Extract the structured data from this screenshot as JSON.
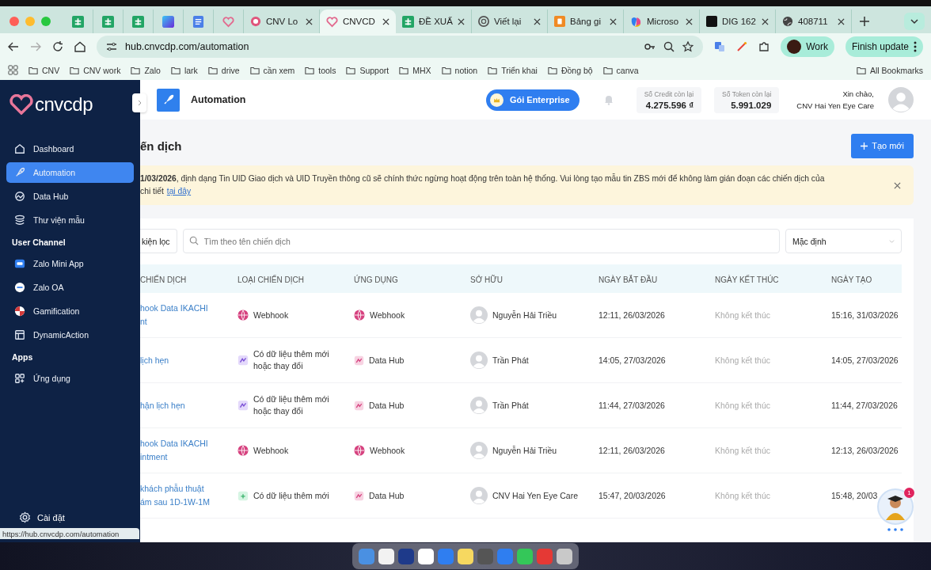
{
  "browser": {
    "tabs": [
      {
        "kind": "sheet",
        "selected": false
      },
      {
        "kind": "sheet",
        "selected": false
      },
      {
        "kind": "sheet",
        "selected": false
      },
      {
        "kind": "gradient",
        "selected": false
      },
      {
        "kind": "doc",
        "selected": false
      },
      {
        "kind": "heart",
        "selected": false
      },
      {
        "kind": "shield",
        "title": "CNV Lo",
        "selected": false
      },
      {
        "kind": "heart",
        "title": "CNVCD",
        "selected": true
      },
      {
        "kind": "sheet",
        "title": "ĐỀ XUẤ",
        "selected": false
      },
      {
        "kind": "knot",
        "title": "Viết lại",
        "selected": false
      },
      {
        "kind": "orange",
        "title": "Bảng gi",
        "selected": false
      },
      {
        "kind": "copilot",
        "title": "Microso",
        "selected": false
      },
      {
        "kind": "ty",
        "title": "DIG 162",
        "selected": false
      },
      {
        "kind": "globe",
        "title": "408711",
        "selected": false
      }
    ],
    "address": "hub.cnvcdp.com/automation",
    "profile": "Work",
    "update": "Finish update",
    "bookmarks": [
      "CNV",
      "CNV work",
      "Zalo",
      "lark",
      "drive",
      "cần xem",
      "tools",
      "Support",
      "MHX",
      "notion",
      "Triển khai",
      "Đồng bộ",
      "canva"
    ],
    "all_bookmarks": "All Bookmarks",
    "status_url": "https://hub.cnvcdp.com/automation"
  },
  "sidebar": {
    "logo": "cnvcdp",
    "nav": [
      {
        "kind": "item",
        "label": "Dashboard",
        "selected": false
      },
      {
        "kind": "item",
        "label": "Automation",
        "selected": true
      },
      {
        "kind": "item",
        "label": "Data Hub",
        "selected": false
      },
      {
        "kind": "item",
        "label": "Thư viện mẫu",
        "selected": false
      },
      {
        "kind": "heading",
        "label": "User Channel"
      },
      {
        "kind": "item",
        "label": "Zalo Mini App",
        "selected": false
      },
      {
        "kind": "item",
        "label": "Zalo OA",
        "selected": false
      },
      {
        "kind": "item",
        "label": "Gamification",
        "selected": false
      },
      {
        "kind": "item",
        "label": "DynamicAction",
        "selected": false
      },
      {
        "kind": "heading",
        "label": "Apps"
      },
      {
        "kind": "item",
        "label": "Ứng dụng",
        "selected": false
      }
    ],
    "settings": "Cài đặt"
  },
  "header": {
    "title": "Automation",
    "plan": "Gói Enterprise",
    "credit": {
      "label": "Số Credit còn lại",
      "value": "4.275.596 ₫"
    },
    "token": {
      "label": "Số Token còn lại",
      "value": "5.991.029"
    },
    "greeting": "Xin chào,",
    "user": "CNV Hai Yen Eye Care"
  },
  "page": {
    "title": "ến dịch",
    "create_button": "Tạo mới",
    "banner": {
      "line1": "**1/03/2026**, định dạng Tin UID Giao dịch và UID Truyền thông cũ sẽ chính thức ngừng hoạt động trên toàn hệ thống. Vui lòng tạo mẫu tin ZBS mới để không làm gián đoạn các chiến dịch của",
      "line2": "chi tiết",
      "link": "tại đây"
    },
    "filter_button": "kiện lọc",
    "search": {
      "placeholder": "Tìm theo tên chiến dịch"
    },
    "sort": "Mặc định",
    "table": {
      "columns": [
        "CHIẾN DỊCH",
        "LOẠI CHIẾN DỊCH",
        "ỨNG DỤNG",
        "SỞ HỮU",
        "NGÀY BẮT ĐẦU",
        "NGÀY KẾT THÚC",
        "NGÀY TẠO"
      ],
      "rows": [
        {
          "name_lines": [
            "hook Data IKACHI",
            "nt"
          ],
          "type": {
            "kind": "webhook",
            "label": "Webhook"
          },
          "app": {
            "kind": "webhook",
            "label": "Webhook"
          },
          "owner": "Nguyễn Hải Triều",
          "start": "12:11, 26/03/2026",
          "end": "Không kết thúc",
          "created": "15:16, 31/03/2026"
        },
        {
          "name_lines": [
            "lịch hẹn"
          ],
          "type": {
            "kind": "record-change",
            "label": "Có dữ liệu thêm mới hoặc thay đổi"
          },
          "app": {
            "kind": "datahub",
            "label": "Data Hub"
          },
          "owner": "Trần Phát",
          "start": "14:05, 27/03/2026",
          "end": "Không kết thúc",
          "created": "14:05, 27/03/2026"
        },
        {
          "name_lines": [
            "hận lịch hẹn"
          ],
          "type": {
            "kind": "record-change",
            "label": "Có dữ liệu thêm mới hoặc thay đổi"
          },
          "app": {
            "kind": "datahub",
            "label": "Data Hub"
          },
          "owner": "Trần Phát",
          "start": "11:44, 27/03/2026",
          "end": "Không kết thúc",
          "created": "11:44, 27/03/2026"
        },
        {
          "name_lines": [
            "hook Data IKACHI",
            "intment"
          ],
          "type": {
            "kind": "webhook",
            "label": "Webhook"
          },
          "app": {
            "kind": "webhook",
            "label": "Webhook"
          },
          "owner": "Nguyễn Hải Triều",
          "start": "12:11, 26/03/2026",
          "end": "Không kết thúc",
          "created": "12:13, 26/03/2026"
        },
        {
          "name_lines": [
            "khách phẫu thuật",
            "ám sau 1D-1W-1M"
          ],
          "type": {
            "kind": "record-new",
            "label": "Có dữ liệu thêm mới"
          },
          "app": {
            "kind": "datahub",
            "label": "Data Hub"
          },
          "owner": "CNV Hai Yen Eye Care",
          "start": "15:47, 20/03/2026",
          "end": "Không kết thúc",
          "created": "15:48, 20/03"
        }
      ]
    },
    "chat": {
      "badge": "1"
    }
  }
}
